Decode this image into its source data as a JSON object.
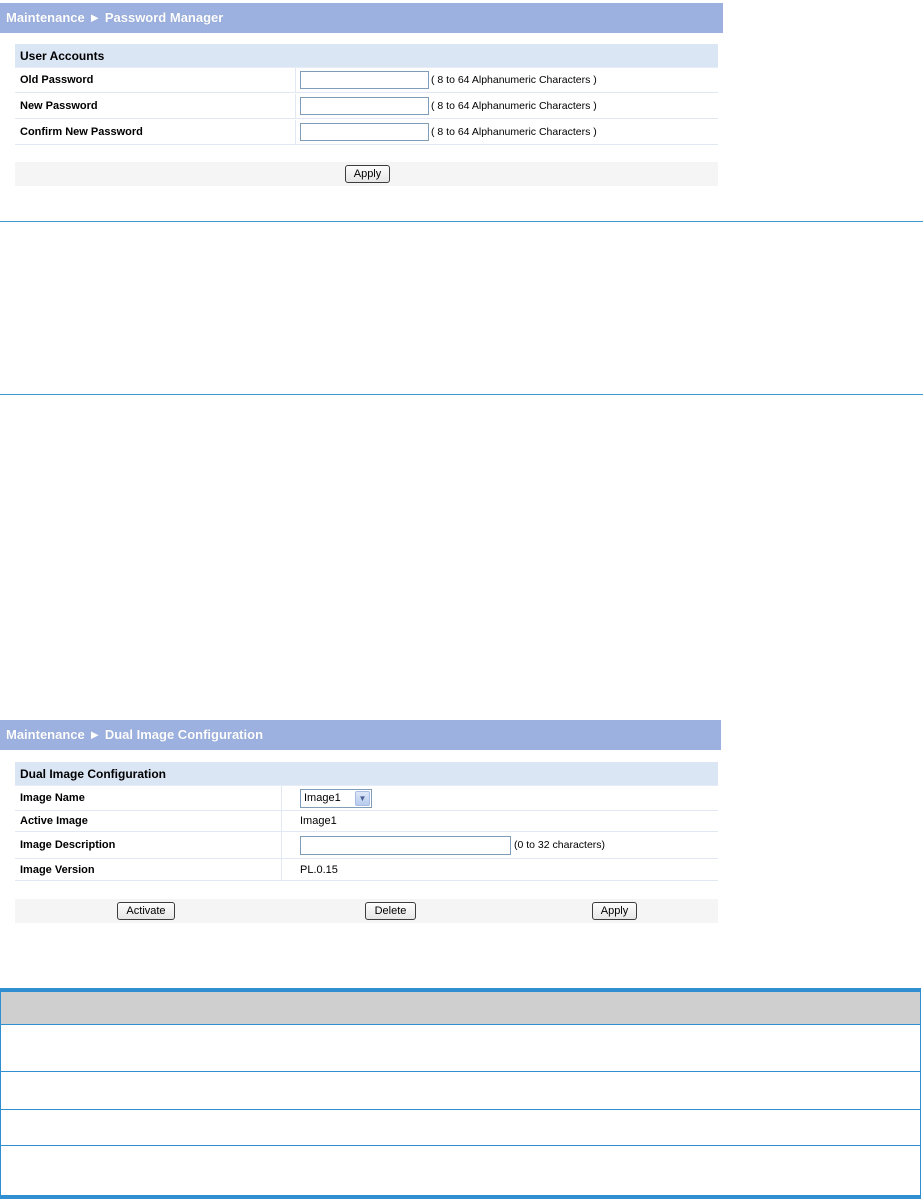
{
  "password_panel": {
    "title": "Maintenance ► Password Manager",
    "section_title": "User Accounts",
    "rows": [
      {
        "label": "Old Password",
        "value": "",
        "hint": "( 8 to 64 Alphanumeric Characters )"
      },
      {
        "label": "New Password",
        "value": "",
        "hint": "( 8 to 64 Alphanumeric Characters )"
      },
      {
        "label": "Confirm New Password",
        "value": "",
        "hint": "( 8 to 64 Alphanumeric Characters )"
      }
    ],
    "apply_label": "Apply"
  },
  "dual_image_panel": {
    "title": "Maintenance ► Dual Image Configuration",
    "section_title": "Dual Image Configuration",
    "image_name": {
      "label": "Image Name",
      "selected": "Image1"
    },
    "active_image": {
      "label": "Active Image",
      "value": "Image1"
    },
    "image_description": {
      "label": "Image Description",
      "value": "",
      "hint": "(0 to 32 characters)"
    },
    "image_version": {
      "label": "Image Version",
      "value": "PL.0.15"
    },
    "buttons": {
      "activate": "Activate",
      "delete": "Delete",
      "apply": "Apply"
    }
  },
  "colors": {
    "panel_title_bg": "#9cb1e0",
    "section_bg": "#dbe6f5",
    "rule_blue": "#3e9bd0",
    "table_header_bg": "#cfcfcf"
  }
}
